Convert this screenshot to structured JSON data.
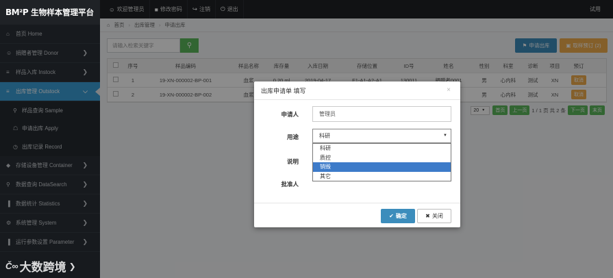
{
  "brand": {
    "logo": "BM²P",
    "system_name": "生物样本管理平台"
  },
  "topnav": {
    "items": [
      {
        "icon": "user-icon",
        "glyph": "☺",
        "label": "欢迎管理员"
      },
      {
        "icon": "lock-icon",
        "glyph": "■",
        "label": "修改密码"
      },
      {
        "icon": "logout-icon",
        "glyph": "↪",
        "label": "注销"
      },
      {
        "icon": "power-icon",
        "glyph": "⏻",
        "label": "退出"
      }
    ],
    "right_label": "试用"
  },
  "sidebar": {
    "items": [
      {
        "icon": "home-icon",
        "glyph": "⌂",
        "label": "首页 Home",
        "has_chevron": false
      },
      {
        "icon": "donor-icon",
        "glyph": "☺",
        "label": "捐赠者管理 Donor",
        "has_chevron": true
      },
      {
        "icon": "instock-icon",
        "glyph": "≡",
        "label": "样品入库 Instock",
        "has_chevron": true
      },
      {
        "icon": "outstock-icon",
        "glyph": "≡",
        "label": "出库管理 Outstock",
        "has_chevron": true,
        "active": true
      }
    ],
    "sub_items": [
      {
        "icon": "search-icon",
        "glyph": "⚲",
        "label": "样品查询 Sample"
      },
      {
        "icon": "apply-icon",
        "glyph": "☖",
        "label": "申请出库 Apply"
      },
      {
        "icon": "record-icon",
        "glyph": "◷",
        "label": "出库记录 Record"
      }
    ],
    "bottom_items": [
      {
        "icon": "container-icon",
        "glyph": "◆",
        "label": "存储设备管理 Container"
      },
      {
        "icon": "datasearch-icon",
        "glyph": "⚲",
        "label": "数据查询 DataSearch"
      },
      {
        "icon": "statistics-icon",
        "glyph": "▐",
        "label": "数据统计 Statistics"
      },
      {
        "icon": "system-icon",
        "glyph": "⚙",
        "label": "系统管理 System"
      },
      {
        "icon": "parameter-icon",
        "glyph": "▐",
        "label": "运行参数设置 Parameter"
      }
    ]
  },
  "breadcrumb": {
    "home": "首页",
    "section": "出库管理",
    "page": "申请出库"
  },
  "toolbar": {
    "search_placeholder": "请输入检索关键字",
    "apply_button": "申请出库",
    "cart_button": "取样预订 (2)"
  },
  "table": {
    "columns": [
      "",
      "序号",
      "样品编码",
      "样品名称",
      "库存量",
      "入库日期",
      "存储位置",
      "ID号",
      "姓名",
      "性别",
      "科室",
      "诊断",
      "项目",
      "预订"
    ],
    "rows": [
      [
        "",
        "1",
        "19-XN-000002-BP-001",
        "血浆",
        "0.20 ml",
        "2019-04-17",
        "F1-A1-A2-A1",
        "130011",
        "捐赠者0001",
        "男",
        "心内科",
        "测试",
        "XN",
        "取消"
      ],
      [
        "",
        "2",
        "19-XN-000002-BP-002",
        "血浆",
        "",
        "",
        "",
        "",
        "0001",
        "男",
        "心内科",
        "测试",
        "XN",
        "取消"
      ]
    ]
  },
  "pager": {
    "page_size": "20",
    "first": "首页",
    "prev": "上一页",
    "info": "1 / 1 页 共 2 条",
    "next": "下一页",
    "last": "末页"
  },
  "modal": {
    "title": "出库申请单 填写",
    "close_glyph": "×",
    "applicant_label": "申请人",
    "applicant_value": "管理员",
    "purpose_label": "用途",
    "purpose_value": "科研",
    "purpose_options": [
      "科研",
      "质控",
      "销毁",
      "其它"
    ],
    "purpose_highlighted": "销毁",
    "note_label": "说明",
    "approver_label": "批准人",
    "ok_button": "确定",
    "close_button": "关闭"
  },
  "watermark": {
    "text": "大数跨境"
  },
  "colors": {
    "accent": "#3c8dbc",
    "active_nav": "#3b9ed8",
    "success": "#5cb85c",
    "warning": "#f0ad4e"
  }
}
